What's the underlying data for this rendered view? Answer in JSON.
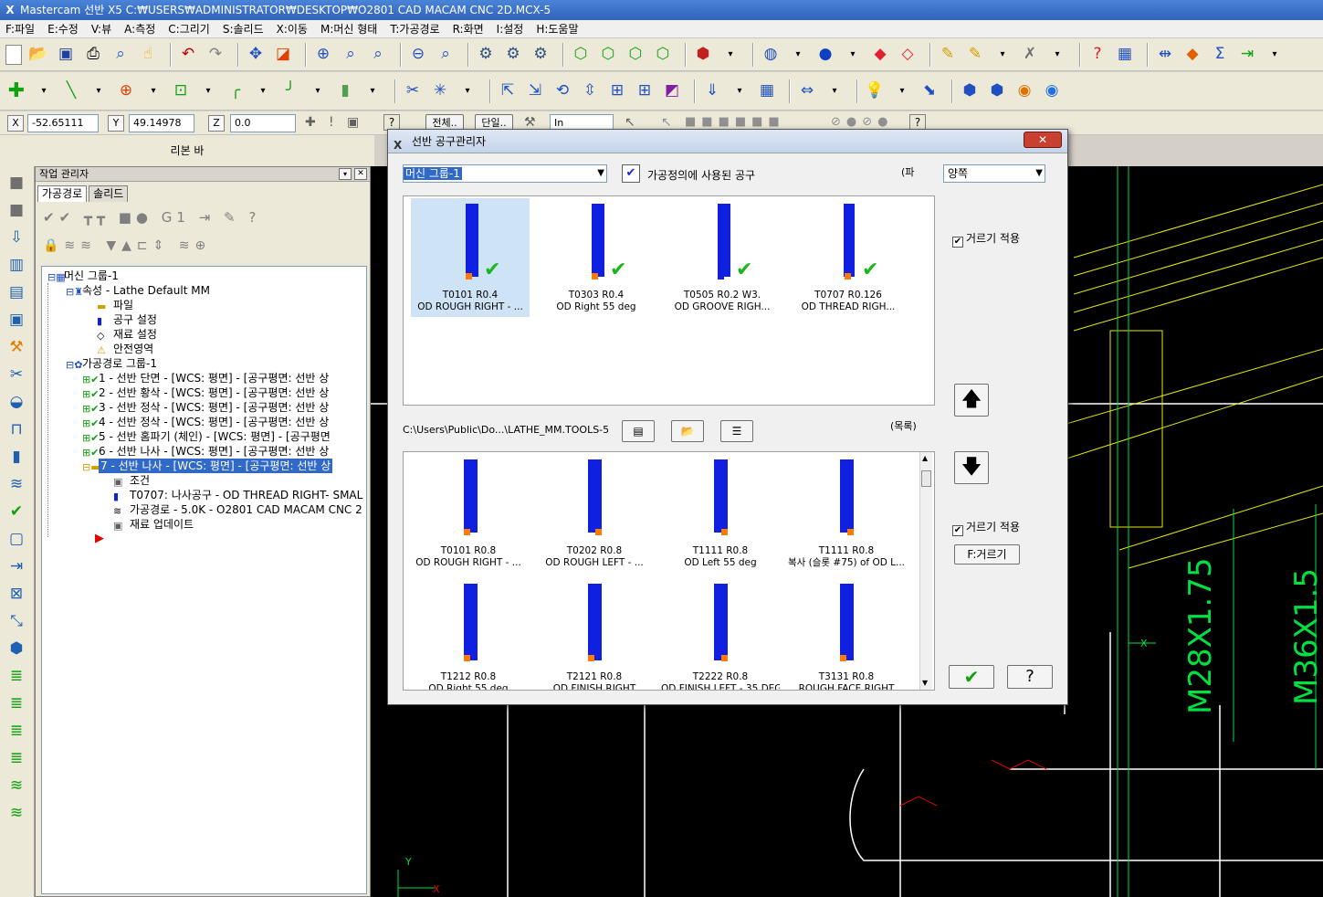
{
  "window": {
    "title": "Mastercam 선반 X5   C:₩USERS₩ADMINISTRATOR₩DESKTOP₩O2801 CAD MACAM CNC 2D.MCX-5"
  },
  "menu": [
    "F:파일",
    "E:수정",
    "V:뷰",
    "A:측정",
    "C:그리기",
    "S:솔리드",
    "X:이동",
    "M:머신 형태",
    "T:가공경로",
    "R:화면",
    "I:설정",
    "H:도움말"
  ],
  "coords": {
    "x_label": "X",
    "x_value": "-52.65111",
    "y_label": "Y",
    "y_value": "49.14978",
    "z_label": "Z",
    "z_value": "0.0",
    "unit": "In",
    "all_label": "전체..",
    "single_label": "단일.."
  },
  "ribbon_label": "리본 바",
  "opmgr": {
    "title": "작업 관리자",
    "tabs": [
      "가공경로",
      "솔리드"
    ],
    "tree": [
      {
        "label": "머신 그룹-1"
      },
      {
        "label": "속성 - Lathe Default MM"
      },
      {
        "label": "파일"
      },
      {
        "label": "공구 설정"
      },
      {
        "label": "재료 설정"
      },
      {
        "label": "안전영역"
      },
      {
        "label": "가공경로 그룹-1"
      },
      {
        "label": "1 - 선반 단면 - [WCS: 평면] - [공구평면: 선반 상"
      },
      {
        "label": "2 - 선반 황삭 - [WCS: 평면] - [공구평면: 선반 상"
      },
      {
        "label": "3 - 선반 정삭 - [WCS: 평면] - [공구평면: 선반 상"
      },
      {
        "label": "4 - 선반 정삭 - [WCS: 평면] - [공구평면: 선반 상"
      },
      {
        "label": "5 - 선반 홈파기 (체인) - [WCS: 평면] - [공구평면"
      },
      {
        "label": "6 - 선반 나사 - [WCS: 평면] - [공구평면: 선반 상"
      },
      {
        "label": "7 - 선반 나사 - [WCS: 평면] - [공구평면: 선반 상"
      },
      {
        "label": "조건"
      },
      {
        "label": "T0707: 나사공구 - OD THREAD RIGHT- SMAL"
      },
      {
        "label": "가공경로 - 5.0K - O2801 CAD MACAM CNC 2"
      },
      {
        "label": "재료 업데이트"
      }
    ]
  },
  "dialog": {
    "title": "선반 공구관리자",
    "group_select": "머신 그룹-1",
    "used_tools_label": "가공정의에 사용된 공구",
    "filter_char": "(파",
    "side_select": "양쪽",
    "filter_apply_1": "거르기 적용",
    "filter_apply_2": "거르기 적용",
    "filter_button": "F:거르기",
    "library_path": "C:\\Users\\Public\\Do...\\LATHE_MM.TOOLS-5",
    "list_label": "(목록)",
    "used_tools": [
      {
        "id": "T0101 R0.4",
        "desc": "OD ROUGH RIGHT - ..."
      },
      {
        "id": "T0303 R0.4",
        "desc": "OD Right 55 deg"
      },
      {
        "id": "T0505 R0.2 W3.",
        "desc": "OD GROOVE RIGH..."
      },
      {
        "id": "T0707 R0.126",
        "desc": "OD THREAD RIGH..."
      }
    ],
    "library_tools": [
      {
        "id": "T0101 R0.8",
        "desc": "OD ROUGH RIGHT - ..."
      },
      {
        "id": "T0202 R0.8",
        "desc": "OD ROUGH LEFT - ..."
      },
      {
        "id": "T1111 R0.8",
        "desc": "OD Left 55 deg"
      },
      {
        "id": "T1111 R0.8",
        "desc": "복사 (슬롯 #75) of OD L..."
      },
      {
        "id": "T1212 R0.8",
        "desc": "OD Right 55 deg"
      },
      {
        "id": "T2121 R0.8",
        "desc": "OD FINISH RIGHT"
      },
      {
        "id": "T2222 R0.8",
        "desc": "OD FINISH LEFT - 35 DEG"
      },
      {
        "id": "T3131 R0.8",
        "desc": "ROUGH FACE RIGHT"
      }
    ]
  },
  "cad": {
    "dim1": "M28X1.75",
    "dim2": "M36X1.5",
    "axis_x": "X",
    "axis_y": "Y"
  }
}
